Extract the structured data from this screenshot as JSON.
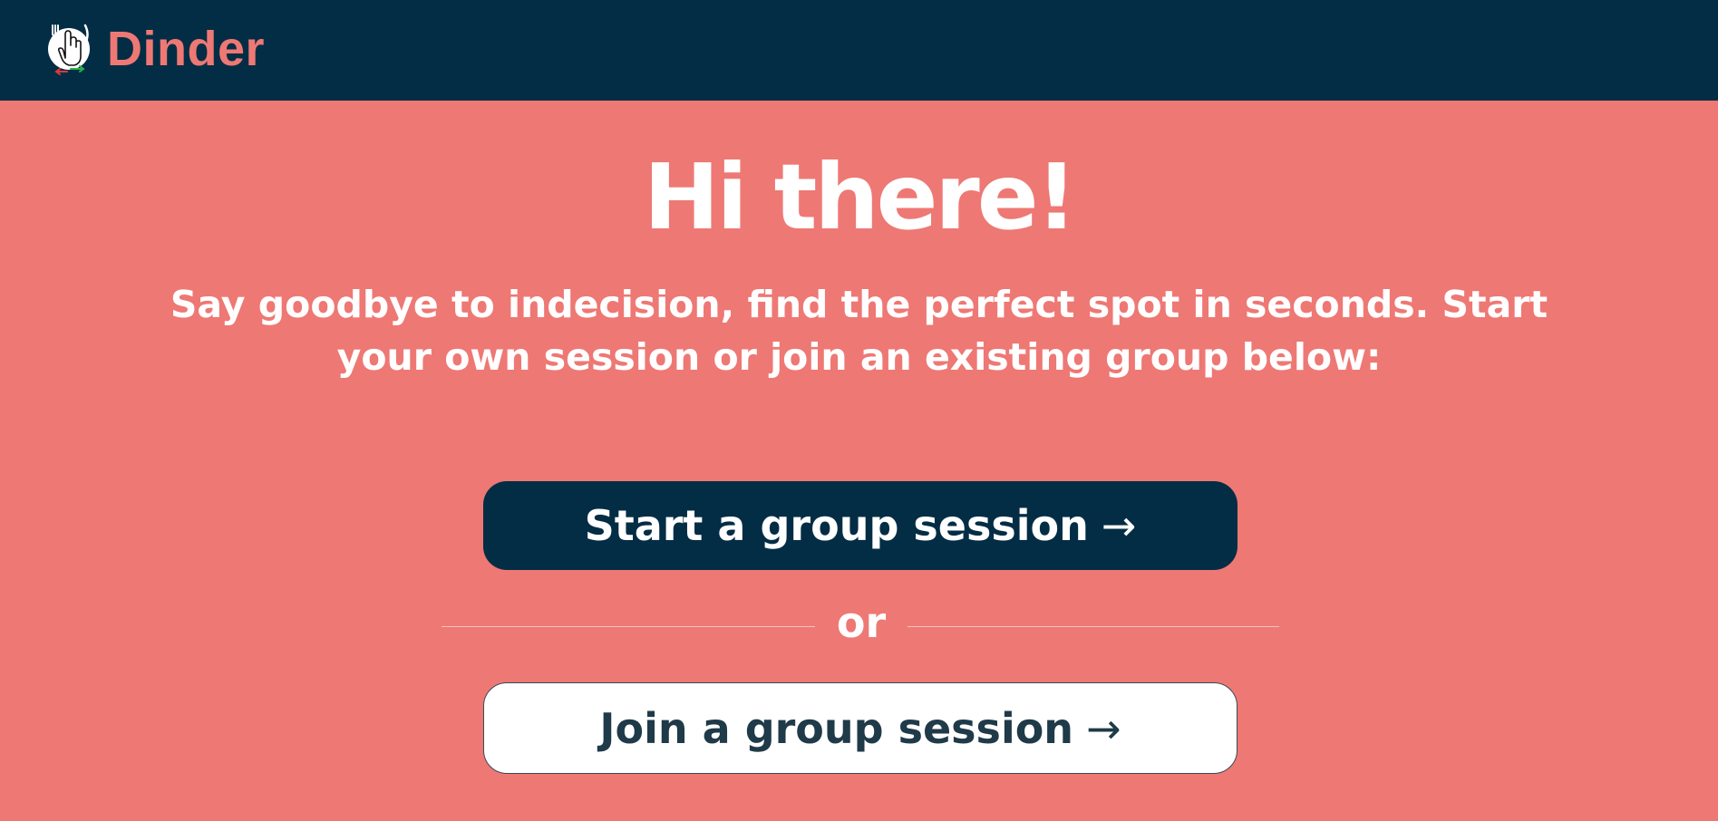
{
  "header": {
    "brand_name": "Dinder",
    "logo_icon": "hand-swipe-fork-knife-logo-icon"
  },
  "colors": {
    "header_bg": "#032d45",
    "page_bg": "#ee7874",
    "accent": "#ee7874",
    "primary_button": "#032d45",
    "text_light": "#ffffff"
  },
  "hero": {
    "title": "Hi there!",
    "subtitle": "Say goodbye to indecision, find the perfect spot in seconds. Start your own session or join an existing group below:"
  },
  "actions": {
    "start_label": "Start a group session",
    "join_label": "Join a group session",
    "arrow": "→",
    "divider_text": "or"
  }
}
